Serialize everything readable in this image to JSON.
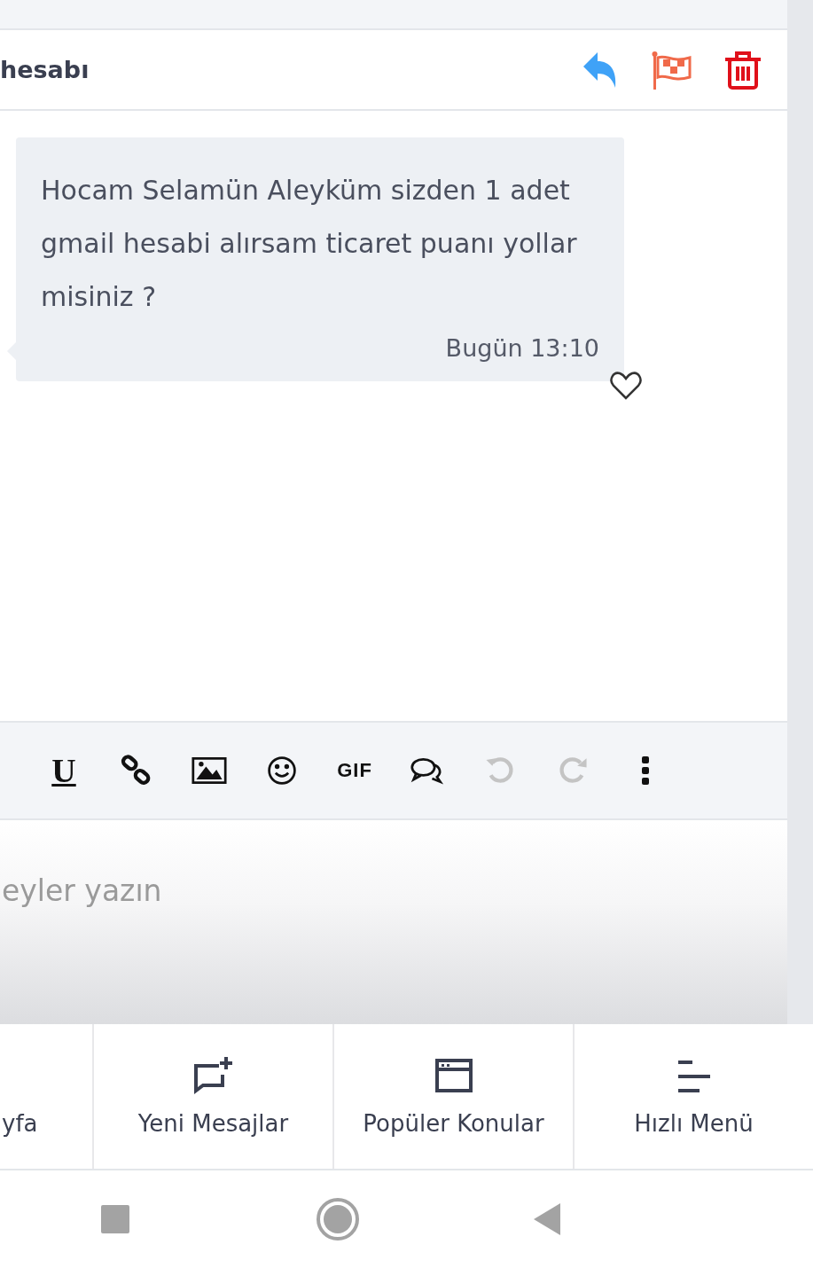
{
  "header": {
    "title": "hesabı",
    "actions": [
      {
        "kind": "reply"
      },
      {
        "kind": "flag"
      },
      {
        "kind": "delete"
      }
    ]
  },
  "message": {
    "text": "Hocam Selamün Aleyküm sizden 1 adet gmail hesabi alırsam ticaret puanı yollar misiniz ?",
    "time": "Bugün 13:10",
    "liked": false
  },
  "toolbar": [
    {
      "kind": "underline",
      "label": "U",
      "disabled": false
    },
    {
      "kind": "link",
      "disabled": false
    },
    {
      "kind": "image",
      "disabled": false
    },
    {
      "kind": "smile",
      "disabled": false
    },
    {
      "kind": "gif",
      "label": "GIF",
      "disabled": false
    },
    {
      "kind": "quote",
      "disabled": false
    },
    {
      "kind": "undo",
      "disabled": true
    },
    {
      "kind": "redo",
      "disabled": true
    },
    {
      "kind": "more",
      "disabled": false
    }
  ],
  "editor": {
    "placeholder": "eyler yazın"
  },
  "bottom_nav": [
    {
      "label": "yfa"
    },
    {
      "label": "Yeni Mesajlar",
      "kind": "new-message"
    },
    {
      "label": "Popüler Konular",
      "kind": "window"
    },
    {
      "label": "Hızlı Menü",
      "kind": "menu"
    }
  ]
}
